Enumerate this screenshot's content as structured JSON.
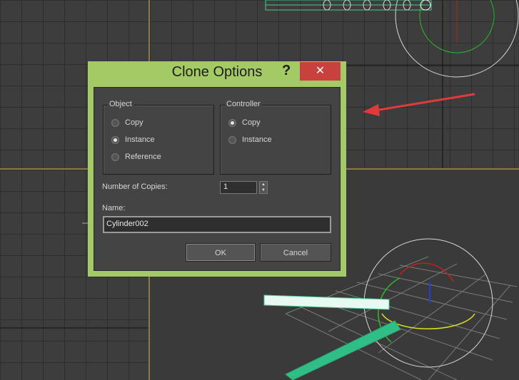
{
  "dialog": {
    "title": "Clone Options",
    "help_glyph": "?",
    "close_glyph": "✕",
    "object_group": {
      "label": "Object",
      "options": [
        "Copy",
        "Instance",
        "Reference"
      ],
      "selected": "Instance"
    },
    "controller_group": {
      "label": "Controller",
      "options": [
        "Copy",
        "Instance"
      ],
      "selected": "Copy"
    },
    "copies_label": "Number of Copies:",
    "copies_value": "1",
    "name_label": "Name:",
    "name_value": "Cylinder002",
    "ok_label": "OK",
    "cancel_label": "Cancel"
  },
  "colors": {
    "dialog_frame": "#a3ca64",
    "close_button": "#c8413c",
    "viewport_border": "#8a7a4a",
    "cylinder": "#3fcf94",
    "arrow": "#e03a3a"
  },
  "icons": [
    "question-mark-icon",
    "close-icon",
    "spinner-arrows-icon",
    "red-arrow-annotation"
  ]
}
